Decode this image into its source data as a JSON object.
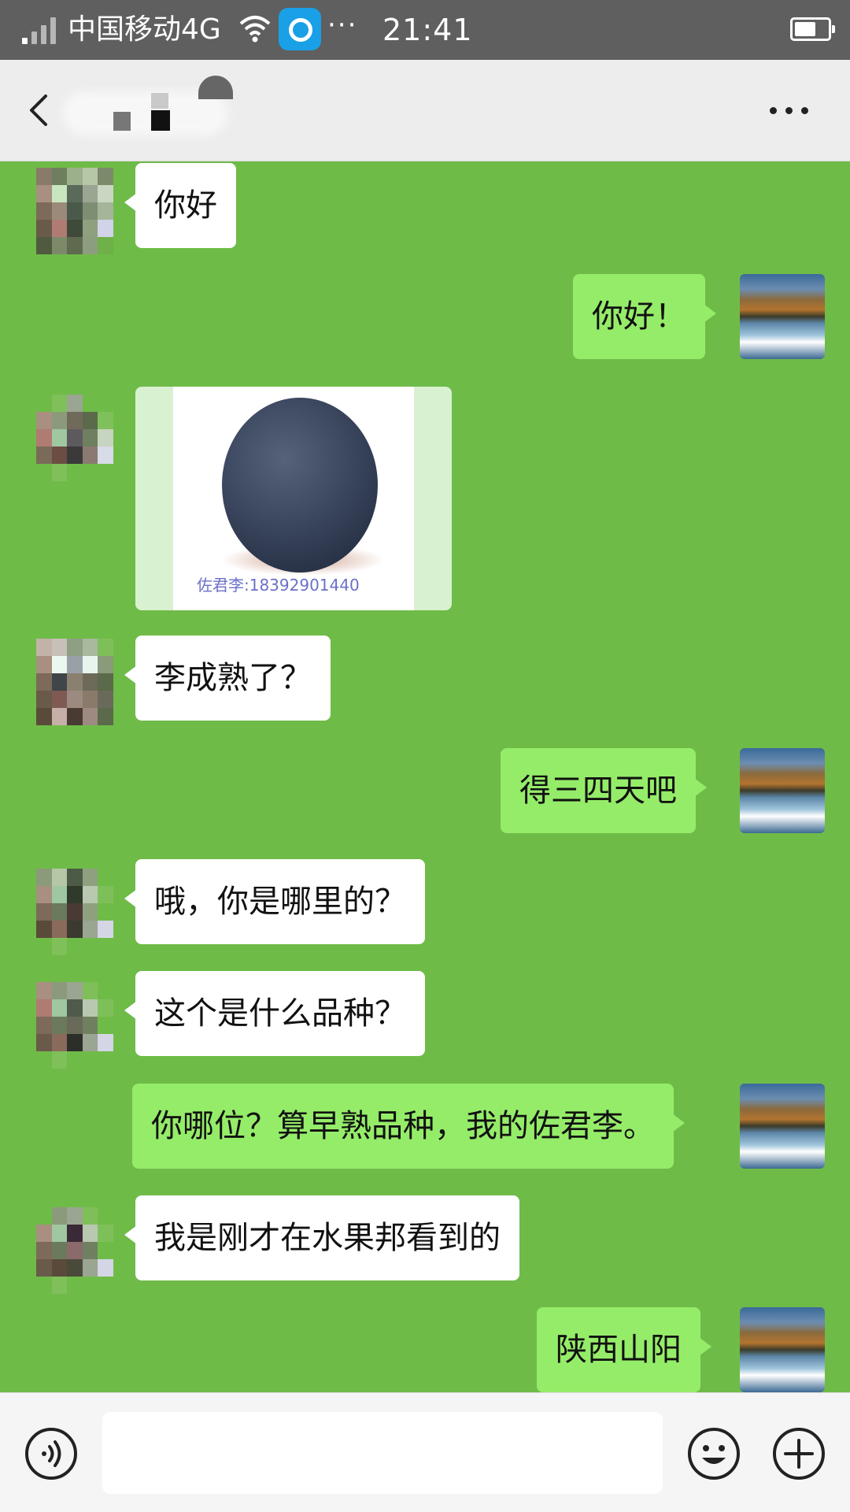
{
  "status_bar": {
    "carrier": "中国移动4G",
    "more": "···",
    "time": "21:41"
  },
  "title_bar": {
    "contact_name": ""
  },
  "messages": [
    {
      "side": "in",
      "type": "text",
      "text": "你好"
    },
    {
      "side": "out",
      "type": "text",
      "text": "你好！"
    },
    {
      "side": "in",
      "type": "image",
      "image_desc": "plum-photo",
      "watermark": "佐君李:18392901440"
    },
    {
      "side": "in",
      "type": "text",
      "text": "李成熟了？"
    },
    {
      "side": "out",
      "type": "text",
      "text": "得三四天吧"
    },
    {
      "side": "in",
      "type": "text",
      "text": "哦，你是哪里的？"
    },
    {
      "side": "in",
      "type": "text",
      "text": "这个是什么品种？"
    },
    {
      "side": "out",
      "type": "text",
      "text": "你哪位？算早熟品种，我的佐君李。"
    },
    {
      "side": "in",
      "type": "text",
      "text": "我是刚才在水果邦看到的"
    },
    {
      "side": "out",
      "type": "text",
      "text": "陕西山阳"
    }
  ],
  "input_bar": {
    "value": "",
    "placeholder": ""
  },
  "colors": {
    "chat_background": "#6fbb48",
    "outgoing_bubble": "#95ec69",
    "incoming_bubble": "#ffffff",
    "status_bar": "#5f5f5f",
    "title_bar": "#ededed"
  }
}
